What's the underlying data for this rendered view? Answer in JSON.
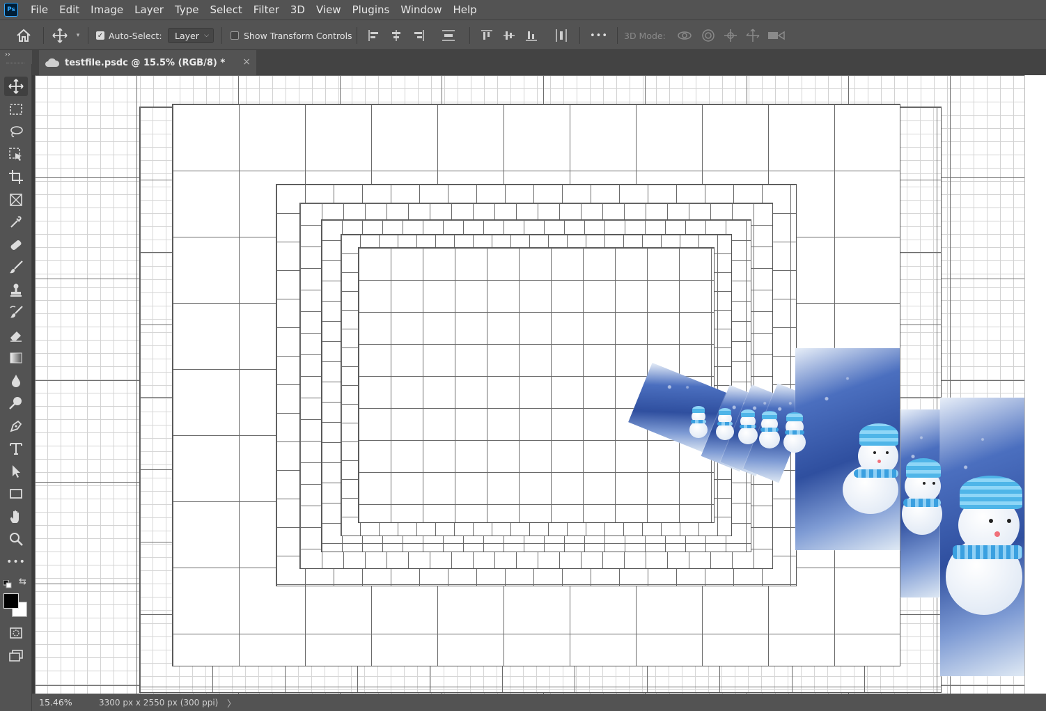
{
  "app": {
    "logo_text": "Ps",
    "menu": [
      "File",
      "Edit",
      "Image",
      "Layer",
      "Type",
      "Select",
      "Filter",
      "3D",
      "View",
      "Plugins",
      "Window",
      "Help"
    ]
  },
  "options": {
    "auto_select_label": "Auto-Select:",
    "auto_select_checked": true,
    "auto_select_target": "Layer",
    "show_transform_label": "Show Transform Controls",
    "show_transform_checked": false,
    "three_d_mode_label": "3D Mode:",
    "more_label": "•••"
  },
  "panel": {
    "collapse_label": "››"
  },
  "document": {
    "tab_title": "testfile.psdc @ 15.5% (RGB/8) *",
    "close_glyph": "×"
  },
  "status": {
    "zoom": "15.46%",
    "doc_info": "3300 px x 2550 px (300 ppi)",
    "arrow": "〉"
  },
  "toolbar": {
    "tools": [
      "move",
      "marquee",
      "lasso",
      "object-select",
      "crop",
      "frame",
      "eyedropper",
      "healing",
      "brush",
      "stamp",
      "history-brush",
      "eraser",
      "gradient",
      "blur",
      "dodge",
      "pen",
      "type",
      "path-select",
      "rectangle",
      "hand",
      "zoom",
      "more"
    ],
    "more_label": "•••",
    "foreground_color": "#000000",
    "background_color": "#ffffff"
  },
  "colors": {
    "ui_bg": "#535353",
    "tab_bar": "#434343",
    "accent": "#31a8ff"
  }
}
